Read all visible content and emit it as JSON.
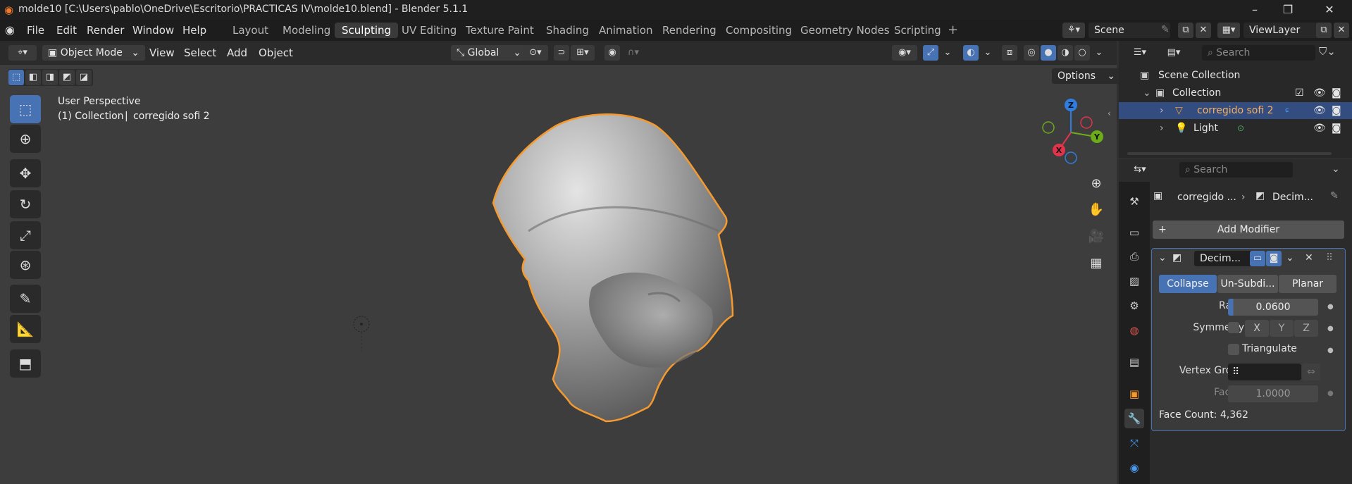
{
  "window": {
    "title": "molde10 [C:\\Users\\pablo\\OneDrive\\Escritorio\\PRACTICAS IV\\molde10.blend] - Blender 5.1.1"
  },
  "menubar": {
    "menus": [
      "File",
      "Edit",
      "Render",
      "Window",
      "Help"
    ],
    "workspaces": [
      "Layout",
      "Modeling",
      "Sculpting",
      "UV Editing",
      "Texture Paint",
      "Shading",
      "Animation",
      "Rendering",
      "Compositing",
      "Geometry Nodes",
      "Scripting"
    ],
    "active_workspace": "Sculpting",
    "scene": "Scene",
    "view_layer": "ViewLayer"
  },
  "viewport_header": {
    "mode": "Object Mode",
    "menus": [
      "View",
      "Select",
      "Add",
      "Object"
    ],
    "orientation": "Global",
    "options_label": "Options"
  },
  "viewport": {
    "perspective": "User Perspective",
    "collection_line": "(1) Collection",
    "object_name": "corregido sofi 2",
    "gizmo": {
      "z": "Z",
      "y": "Y",
      "x": "X"
    }
  },
  "outliner": {
    "search_placeholder": "Search",
    "scene_collection": "Scene Collection",
    "collection": "Collection",
    "items": [
      {
        "label": "corregido sofi 2",
        "selected": true
      },
      {
        "label": "Light",
        "selected": false
      }
    ]
  },
  "properties": {
    "search_placeholder": "Search",
    "breadcrumb_object": "corregido ...",
    "breadcrumb_modifier": "Decim...",
    "add_modifier": "Add Modifier",
    "modifier": {
      "name": "Decim...",
      "modes": [
        "Collapse",
        "Un-Subdi...",
        "Planar"
      ],
      "active_mode": "Collapse",
      "ratio_label": "Ratio",
      "ratio": "0.0600",
      "symmetry_label": "Symmetry",
      "axes": [
        "X",
        "Y",
        "Z"
      ],
      "triangulate_label": "Triangulate",
      "vertex_group_label": "Vertex Group",
      "factor_label": "Factor",
      "factor": "1.0000",
      "face_count": "Face Count: 4,362"
    }
  },
  "colors": {
    "accent": "#4772b3",
    "selection_outline": "#f59a2e",
    "panel": "#2b2b2b"
  }
}
